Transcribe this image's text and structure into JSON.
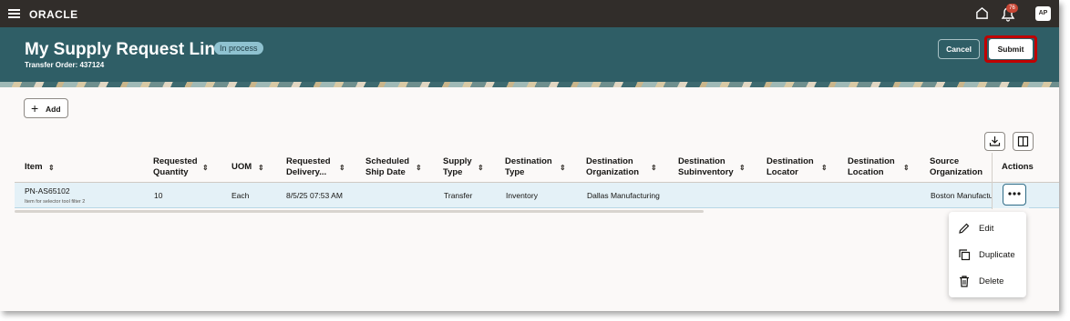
{
  "header": {
    "logo": "ORACLE",
    "notification_count": "76",
    "avatar_initials": "AP"
  },
  "page": {
    "title": "My Supply Request Lines",
    "status": "In process",
    "subtitle": "Transfer Order: 437124",
    "cancel_label": "Cancel",
    "submit_label": "Submit"
  },
  "toolbar": {
    "add_label": "Add"
  },
  "table": {
    "columns": [
      [
        "Item",
        ""
      ],
      [
        "Requested",
        "Quantity"
      ],
      [
        "UOM",
        ""
      ],
      [
        "Requested",
        "Delivery..."
      ],
      [
        "Scheduled",
        "Ship Date"
      ],
      [
        "Supply",
        "Type"
      ],
      [
        "Destination",
        "Type"
      ],
      [
        "Destination",
        "Organization"
      ],
      [
        "Destination",
        "Subinventory"
      ],
      [
        "Destination",
        "Locator"
      ],
      [
        "Destination",
        "Location"
      ],
      [
        "Source",
        "Organization"
      ],
      [
        "Actions",
        ""
      ]
    ],
    "row": {
      "item": "PN-AS65102",
      "item_description": "Item for selector tool filter 2",
      "requested_quantity": "10",
      "uom": "Each",
      "requested_delivery": "8/5/25 07:53 AM",
      "scheduled_ship_date": "",
      "supply_type": "Transfer",
      "destination_type": "Inventory",
      "destination_organization": "Dallas Manufacturing",
      "destination_subinventory": "",
      "destination_locator": "",
      "destination_location": "",
      "source_organization": "Boston Manufactu"
    }
  },
  "menu": {
    "items": [
      "Edit",
      "Duplicate",
      "Delete"
    ]
  },
  "colors": {
    "header_bg": "#312d2a",
    "page_header_bg": "#2f5e66",
    "status_badge": "#8fc2d0",
    "selected_row": "#e4f1f7",
    "highlight_ring": "#c00000"
  }
}
